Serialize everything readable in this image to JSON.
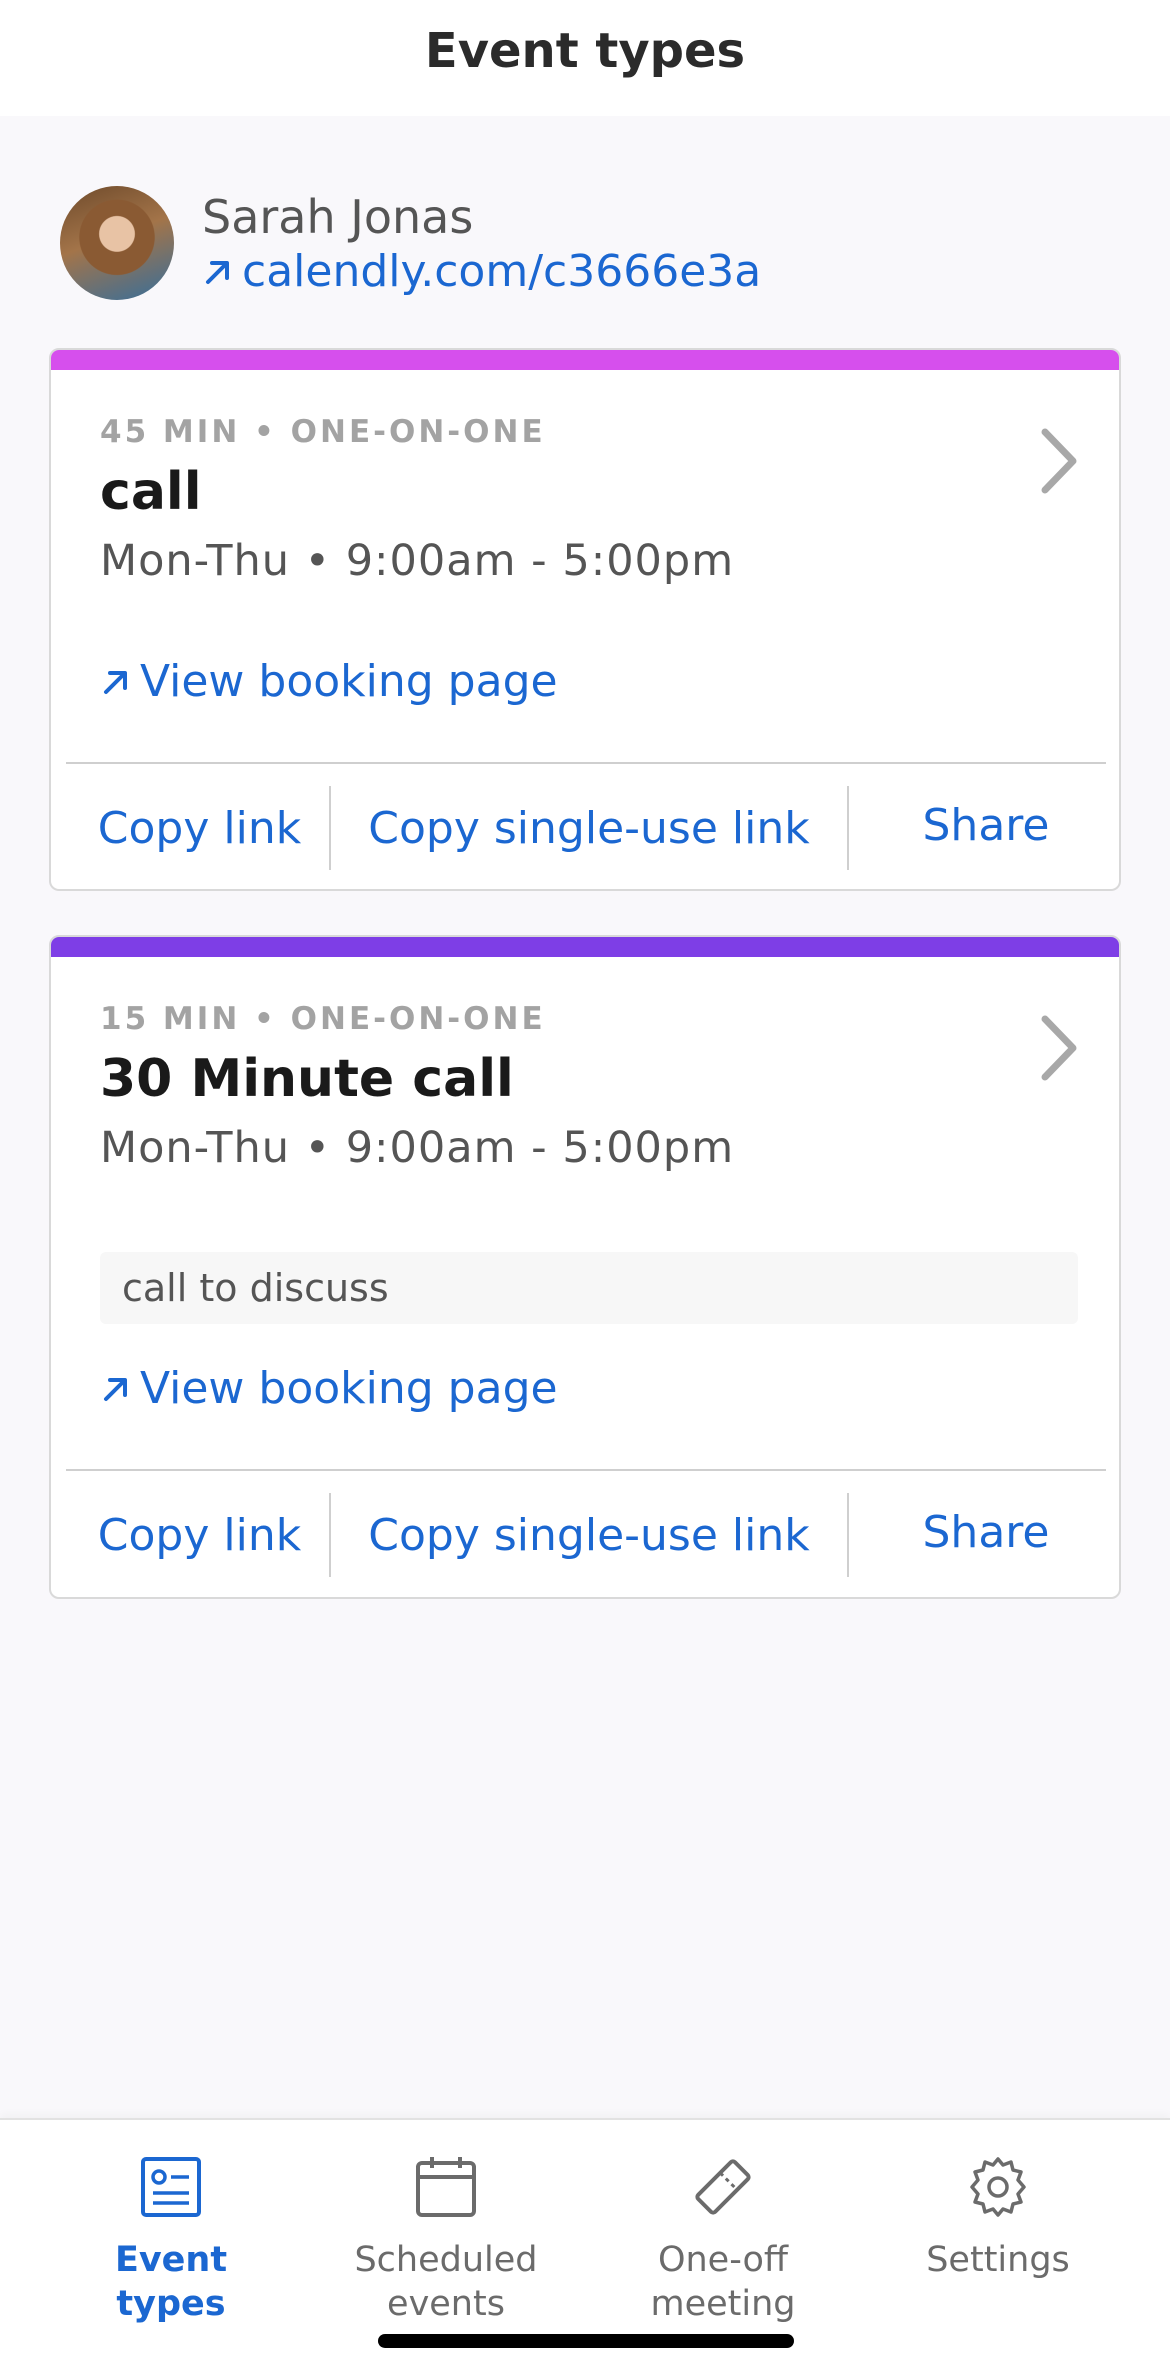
{
  "header": {
    "title": "Event types"
  },
  "profile": {
    "name": "Sarah Jonas",
    "link": "calendly.com/c3666e3a"
  },
  "event_types": [
    {
      "stripe_color": "#d64fed",
      "meta": "45 MIN • ONE-ON-ONE",
      "title": "call",
      "hours": "Mon-Thu • 9:00am - 5:00pm",
      "view_link": "View booking page",
      "actions": {
        "copy_link": "Copy link",
        "copy_single_use": "Copy single-use link",
        "share": "Share"
      }
    },
    {
      "stripe_color": "#7e3ee6",
      "meta": "15 MIN • ONE-ON-ONE",
      "title": "30 Minute call",
      "hours": "Mon-Thu • 9:00am - 5:00pm",
      "description": "call to discuss",
      "view_link": "View booking page",
      "actions": {
        "copy_link": "Copy link",
        "copy_single_use": "Copy single-use link",
        "share": "Share"
      }
    }
  ],
  "tabbar": {
    "items": [
      {
        "label": "Event types",
        "icon": "event-types-icon",
        "active": true
      },
      {
        "label": "Scheduled\nevents",
        "icon": "calendar-icon",
        "active": false
      },
      {
        "label": "One-off\nmeeting",
        "icon": "ticket-icon",
        "active": false
      },
      {
        "label": "Settings",
        "icon": "gear-icon",
        "active": false
      }
    ]
  },
  "colors": {
    "accent": "#1b67d1",
    "background": "#f9f8fb"
  }
}
